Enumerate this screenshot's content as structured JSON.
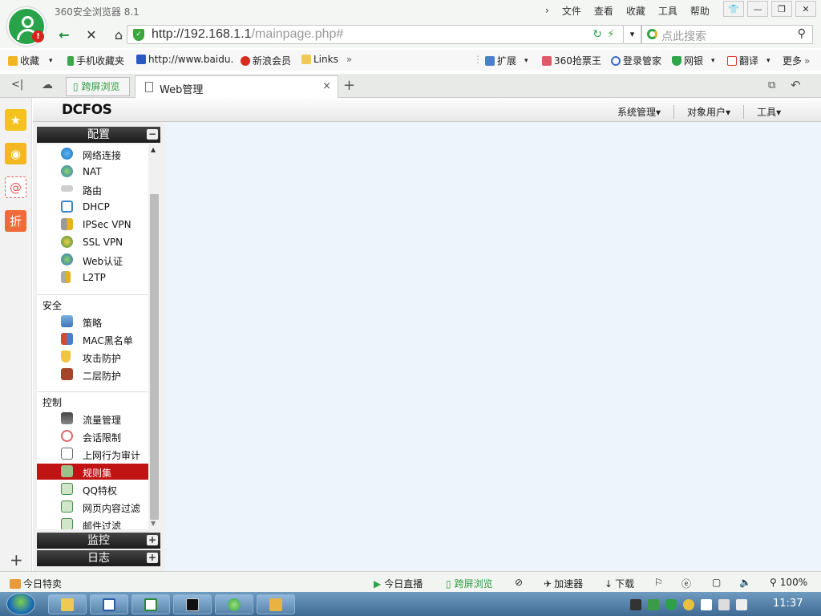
{
  "browser": {
    "title": "360安全浏览器 8.1",
    "menu": [
      "文件",
      "查看",
      "收藏",
      "工具",
      "帮助"
    ],
    "window_buttons": [
      "skin-icon",
      "minimize-icon",
      "maximize-icon",
      "close-icon"
    ]
  },
  "address": {
    "url_host": "http://192.168.1.1",
    "url_path": "/mainpage.php#",
    "search_placeholder": "点此搜索"
  },
  "bookmarks": {
    "items": [
      "收藏",
      "手机收藏夹",
      "http://www.baidu.",
      "新浪会员",
      "Links"
    ],
    "right_items": [
      "扩展",
      "360抢票王",
      "登录管家",
      "网银",
      "翻译",
      "更多"
    ]
  },
  "tabs": {
    "kuaping": "跨屏浏览",
    "active": "Web管理"
  },
  "app": {
    "logo": "DCFOS",
    "menu": [
      "系统管理",
      "对象用户",
      "工具"
    ]
  },
  "sidebar": {
    "config_header": "配置",
    "config_items": [
      "网络连接",
      "NAT",
      "路由",
      "DHCP",
      "IPSec VPN",
      "SSL VPN",
      "Web认证",
      "L2TP"
    ],
    "security_label": "安全",
    "security_items": [
      "策略",
      "MAC黑名单",
      "攻击防护",
      "二层防护"
    ],
    "control_label": "控制",
    "control_items": [
      "流量管理",
      "会话限制",
      "上网行为审计",
      "规则集",
      "QQ特权",
      "网页内容过滤",
      "邮件过滤"
    ],
    "selected_item": "规则集",
    "monitor_header": "监控",
    "log_header": "日志"
  },
  "statusbar": {
    "left": "今日特卖",
    "live": "今日直播",
    "kuaping": "跨屏浏览",
    "accelerator": "加速器",
    "download": "下载",
    "zoom": "100%"
  },
  "taskbar": {
    "clock": "11:37"
  },
  "colors": {
    "selected_bg": "#c01313",
    "accent_green": "#2fa348"
  }
}
